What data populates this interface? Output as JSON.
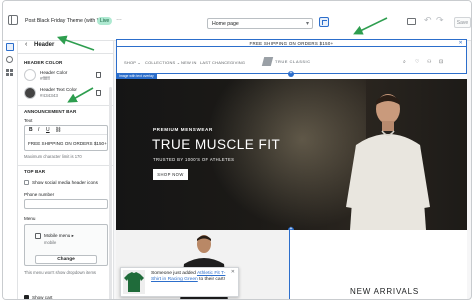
{
  "topbar": {
    "theme_name": "Post Black Friday Theme (with WAR)",
    "live_badge": "Live",
    "more_icon": "…",
    "page_select": "Home page",
    "undo_icon": "↶",
    "redo_icon": "↷",
    "save_label": "Save"
  },
  "panel": {
    "back_icon": "‹",
    "title": "Header",
    "header_color_title": "HEADER COLOR",
    "header_color_label": "Header Color",
    "header_color_value": "#ffffff",
    "header_color_hex": "#ffffff",
    "header_text_color_label": "Header Text Color",
    "header_text_color_value": "#434343",
    "header_text_color_hex": "#434343",
    "announcement_title": "ANNOUNCEMENT BAR",
    "text_label": "Text",
    "rte_bold": "B",
    "rte_italic": "I",
    "rte_underline": "U",
    "rte_link": "⛓",
    "announcement_text": "FREE SHIPPING ON ORDERS $150+",
    "max_chars_help": "Maximum character limit is 170",
    "top_bar_title": "TOP BAR",
    "social_icons_label": "Show social media header icons",
    "social_icons_checked": false,
    "phone_label": "Phone number",
    "menu_label": "Menu",
    "menu_name": "Mobile menu",
    "menu_handle": "mobile",
    "change_label": "Change",
    "dropdown_help": "This menu won't show dropdown items",
    "show_cart_label": "Show cart",
    "show_cart_checked": true
  },
  "preview": {
    "announcement": "FREE SHIPPING ON ORDERS $150+",
    "close_icon": "✕",
    "nav": [
      "SHOP",
      "COLLECTIONS",
      "NEW IN",
      "LAST CHANCE",
      "GIVING"
    ],
    "nav_chevron": "⌄",
    "logo_text": "TRUE CLASSIC",
    "header_icons": [
      "⌕",
      "♡",
      "⚇",
      "⊡"
    ],
    "selected_tag": "Image with text overlay",
    "plus": "+",
    "hero_sub": "PREMIUM MENSWEAR",
    "hero_title": "TRUE MUSCLE FIT",
    "hero_tag": "TRUSTED BY 1000'S OF ATHLETES",
    "hero_button": "SHOP NOW",
    "new_arrivals": "NEW ARRIVALS"
  },
  "toast": {
    "prefix": "Someone just added ",
    "product": "Athletic Fit T-Shirt in Racing Green",
    "suffix": " to their cart!",
    "close_icon": "✕"
  },
  "colors": {
    "accent": "#2c6ecb",
    "arrow": "#2e9e4f",
    "hero_bg": "#1c1a17"
  }
}
